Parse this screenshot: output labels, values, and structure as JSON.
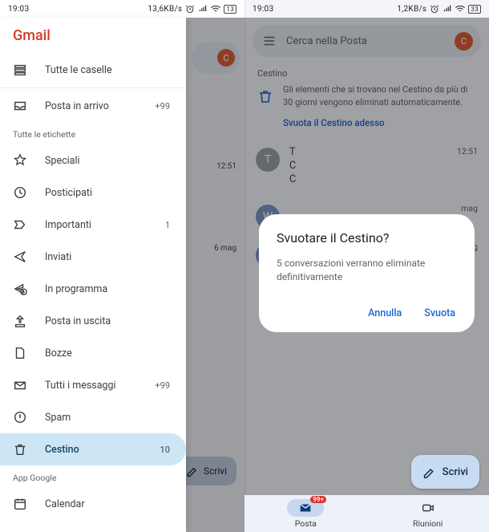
{
  "status": {
    "time": "19:03",
    "net_left": "13,6KB/s",
    "net_right": "1,2KB/s",
    "battery": "13",
    "battery_right": "33"
  },
  "brand": "Gmail",
  "drawer": {
    "top": [
      {
        "icon": "stacked",
        "label": "Tutte le caselle",
        "count": ""
      }
    ],
    "mid": [
      {
        "icon": "inbox",
        "label": "Posta in arrivo",
        "count": "+99"
      }
    ],
    "labels_header": "Tutte le etichette",
    "items": [
      {
        "icon": "star",
        "label": "Speciali",
        "count": ""
      },
      {
        "icon": "clock",
        "label": "Posticipati",
        "count": ""
      },
      {
        "icon": "important",
        "label": "Importanti",
        "count": "1"
      },
      {
        "icon": "sent",
        "label": "Inviati",
        "count": ""
      },
      {
        "icon": "schedule",
        "label": "In programma",
        "count": ""
      },
      {
        "icon": "outbox",
        "label": "Posta in uscita",
        "count": ""
      },
      {
        "icon": "draft",
        "label": "Bozze",
        "count": ""
      },
      {
        "icon": "allmail",
        "label": "Tutti i messaggi",
        "count": "+99"
      },
      {
        "icon": "spam",
        "label": "Spam",
        "count": ""
      },
      {
        "icon": "trash",
        "label": "Cestino",
        "count": "10"
      }
    ],
    "apps_header": "App Google",
    "apps": [
      {
        "icon": "calendar",
        "label": "Calendar",
        "count": ""
      }
    ]
  },
  "left_bg": {
    "avatar": "C",
    "time1": "12:51",
    "time2": "6 mag",
    "compose": "Scrivi"
  },
  "right": {
    "search_placeholder": "Cerca nella Posta",
    "avatar": "C",
    "section": "Cestino",
    "banner_text": "Gli elementi che si trovano nel Cestino da più di 30 giorni vengono eliminati automaticamente.",
    "banner_link": "Svuota il Cestino adesso",
    "msgs": [
      {
        "avatar": "T",
        "color": "#9aa0a6",
        "lines": [
          "T",
          "C",
          "C"
        ],
        "time": "12:51"
      },
      {
        "avatar": "W",
        "color": "#7b93c6",
        "time": "mag"
      },
      {
        "avatar": "W",
        "color": "#7b93c6",
        "time": "mag"
      }
    ],
    "dialog": {
      "title": "Svuotare il Cestino?",
      "body": "5 conversazioni verranno eliminate definitivamente",
      "cancel": "Annulla",
      "confirm": "Svuota"
    },
    "compose": "Scrivi",
    "nav": {
      "mail": "Posta",
      "meet": "Riunioni",
      "badge": "99+"
    }
  }
}
